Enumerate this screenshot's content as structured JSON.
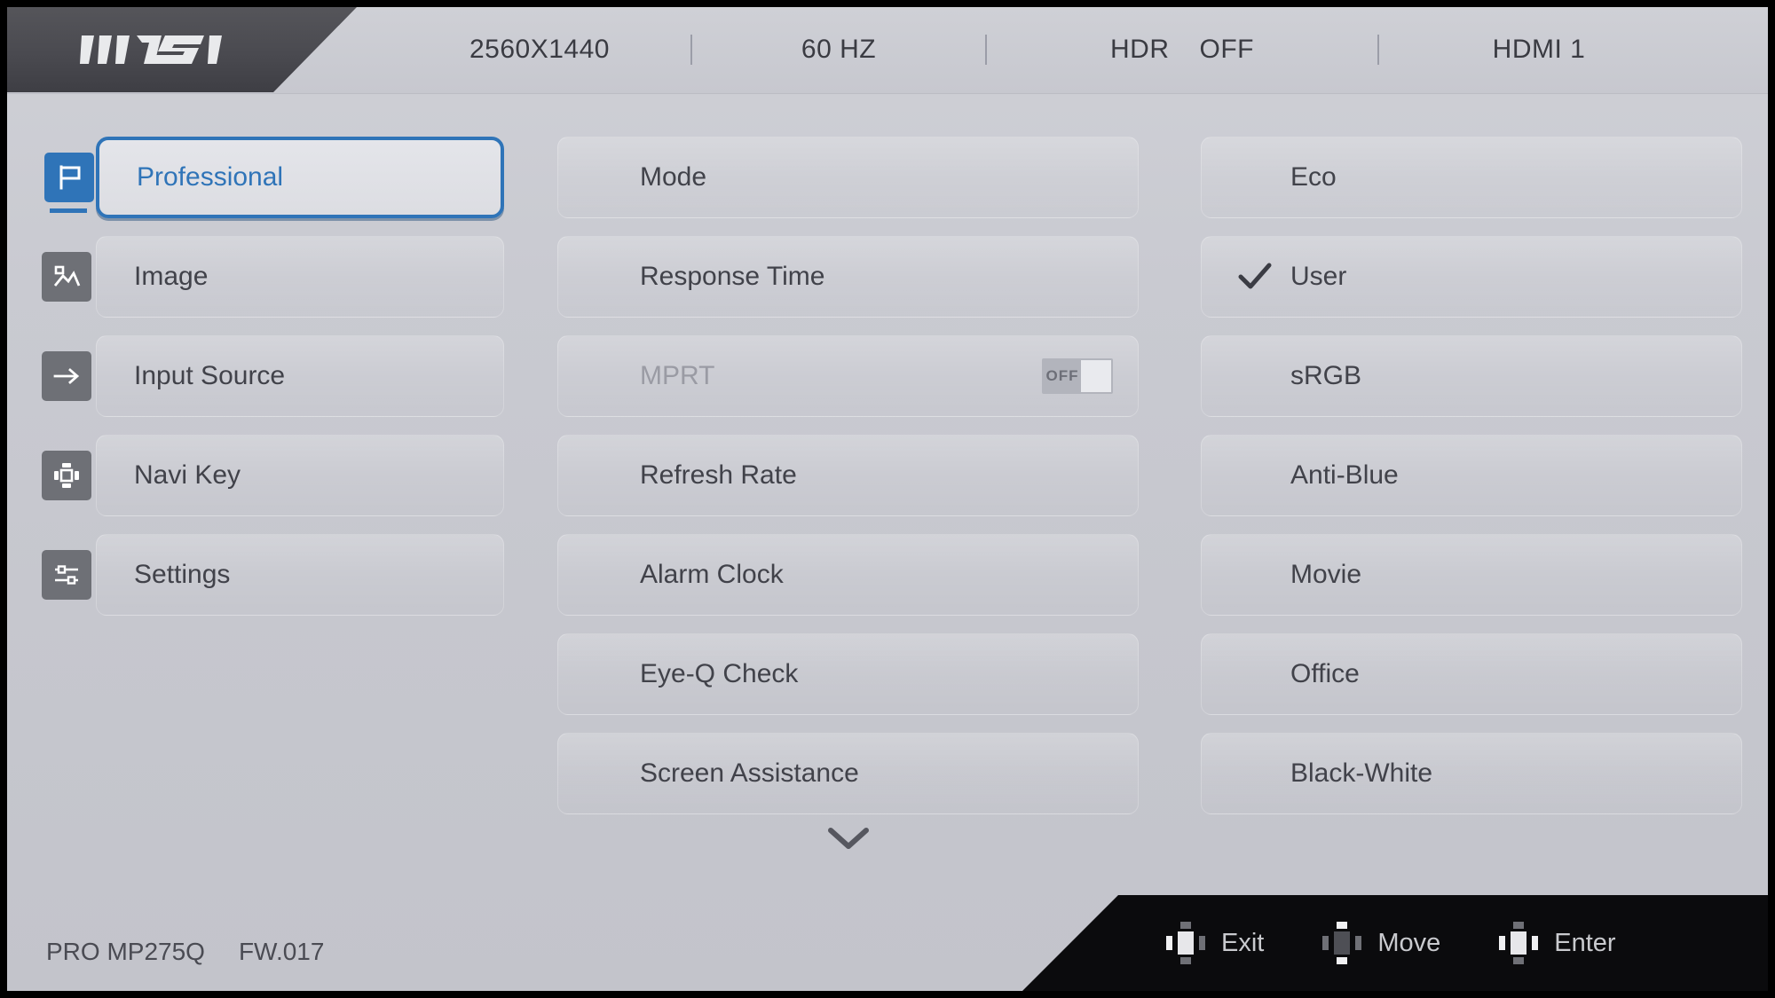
{
  "header": {
    "logo": "msi-logo",
    "status": {
      "resolution": "2560X1440",
      "refresh_rate": "60 HZ",
      "hdr_label": "HDR",
      "hdr_value": "OFF",
      "input_source": "HDMI 1"
    }
  },
  "sidebar": {
    "items": [
      {
        "label": "Professional",
        "icon": "flag-icon",
        "selected": true
      },
      {
        "label": "Image",
        "icon": "picture-icon",
        "selected": false
      },
      {
        "label": "Input Source",
        "icon": "arrow-right-icon",
        "selected": false
      },
      {
        "label": "Navi Key",
        "icon": "dpad-icon",
        "selected": false
      },
      {
        "label": "Settings",
        "icon": "sliders-icon",
        "selected": false
      }
    ]
  },
  "submenu": {
    "items": [
      {
        "label": "Mode",
        "disabled": false,
        "toggle": null
      },
      {
        "label": "Response Time",
        "disabled": false,
        "toggle": null
      },
      {
        "label": "MPRT",
        "disabled": true,
        "toggle": "OFF"
      },
      {
        "label": "Refresh Rate",
        "disabled": false,
        "toggle": null
      },
      {
        "label": "Alarm Clock",
        "disabled": false,
        "toggle": null
      },
      {
        "label": "Eye-Q Check",
        "disabled": false,
        "toggle": null
      },
      {
        "label": "Screen Assistance",
        "disabled": false,
        "toggle": null
      }
    ],
    "scroll_indicator": "chevron-down-icon"
  },
  "options": {
    "items": [
      {
        "label": "Eco",
        "checked": false
      },
      {
        "label": "User",
        "checked": true
      },
      {
        "label": "sRGB",
        "checked": false
      },
      {
        "label": "Anti-Blue",
        "checked": false
      },
      {
        "label": "Movie",
        "checked": false
      },
      {
        "label": "Office",
        "checked": false
      },
      {
        "label": "Black-White",
        "checked": false
      }
    ]
  },
  "footer": {
    "model": "PRO MP275Q",
    "firmware": "FW.017",
    "hints": [
      {
        "label": "Exit",
        "icon": "joystick-left-icon"
      },
      {
        "label": "Move",
        "icon": "joystick-updown-icon"
      },
      {
        "label": "Enter",
        "icon": "joystick-press-icon"
      }
    ]
  },
  "colors": {
    "accent": "#2f74b8",
    "panel": "#c9cad1",
    "text": "#41424a",
    "disabled_text": "#9a9ba4",
    "footer_bg": "#0b0b0d"
  }
}
